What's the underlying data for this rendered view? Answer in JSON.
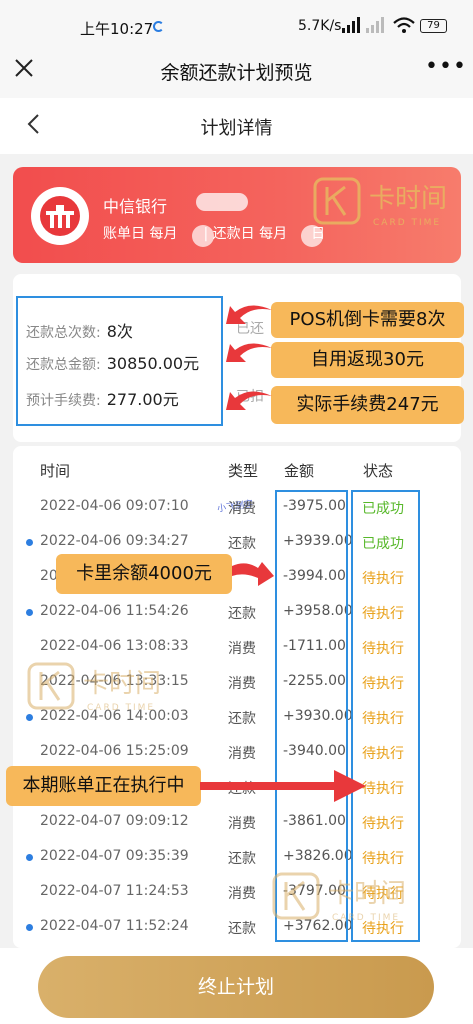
{
  "status_bar": {
    "time": "上午10:27",
    "speed": "5.7K/s",
    "battery": "79"
  },
  "title_bar": {
    "title": "余额还款计划预览"
  },
  "sub_bar": {
    "title": "计划详情"
  },
  "bank_card": {
    "bank_name": "中信银行",
    "bill_text": "账单日 每月",
    "repay_text": "| 还款日 每月",
    "repay_suffix": "日",
    "watermark_cn": "卡时间",
    "watermark_en": "CARD TIME"
  },
  "summary": {
    "count_label": "还款总次数:",
    "count_value": "8次",
    "amount_label": "还款总金额:",
    "amount_value": "30850.00元",
    "fee_label": "预计手续费:",
    "fee_value": "277.00元",
    "faded_1": "已还",
    "faded_2": "已扣"
  },
  "callouts": {
    "c1": "POS机倒卡需要8次",
    "c2": "自用返现30元",
    "c3": "实际手续费247元",
    "c4": "卡里余额4000元",
    "c5": "本期账单正在执行中"
  },
  "table": {
    "headers": {
      "time": "时间",
      "type": "类型",
      "amount": "金额",
      "status": "状态"
    },
    "small_watermark": "小飞测客",
    "rows": [
      {
        "time": "2022-04-06 09:07:10",
        "type": "消费",
        "amount": "-3975.00",
        "status": "已成功"
      },
      {
        "time": "2022-04-06 09:34:27",
        "type": "还款",
        "amount": "+3939.00",
        "status": "已成功"
      },
      {
        "time": "20",
        "type": "",
        "amount": "-3994.00",
        "status": "待执行"
      },
      {
        "time": "2022-04-06 11:54:26",
        "type": "还款",
        "amount": "+3958.00",
        "status": "待执行"
      },
      {
        "time": "2022-04-06 13:08:33",
        "type": "消费",
        "amount": "-1711.00",
        "status": "待执行"
      },
      {
        "time": "2022-04-06 13:33:15",
        "type": "消费",
        "amount": "-2255.00",
        "status": "待执行"
      },
      {
        "time": "2022-04-06 14:00:03",
        "type": "还款",
        "amount": "+3930.00",
        "status": "待执行"
      },
      {
        "time": "2022-04-06 15:25:09",
        "type": "消费",
        "amount": "-3940.00",
        "status": "待执行"
      },
      {
        "time": "",
        "type": "还款",
        "amount": "",
        "status": "待执行"
      },
      {
        "time": "2022-04-07 09:09:12",
        "type": "消费",
        "amount": "-3861.00",
        "status": "待执行"
      },
      {
        "time": "2022-04-07 09:35:39",
        "type": "还款",
        "amount": "+3826.00",
        "status": "待执行"
      },
      {
        "time": "2022-04-07 11:24:53",
        "type": "消费",
        "amount": "-3797.00",
        "status": "待执行"
      },
      {
        "time": "2022-04-07 11:52:24",
        "type": "还款",
        "amount": "+3762.00",
        "status": "待执行"
      }
    ]
  },
  "bottom": {
    "stop_label": "终止计划"
  },
  "colors": {
    "card_red": "#f24d4d",
    "callout_orange": "#f7b85a",
    "annotation_blue": "#2e8fe0",
    "success_green": "#58b82b",
    "pending_orange": "#e9a21c",
    "button_gold": "#d9b06a",
    "arrow_red": "#e8383b"
  }
}
